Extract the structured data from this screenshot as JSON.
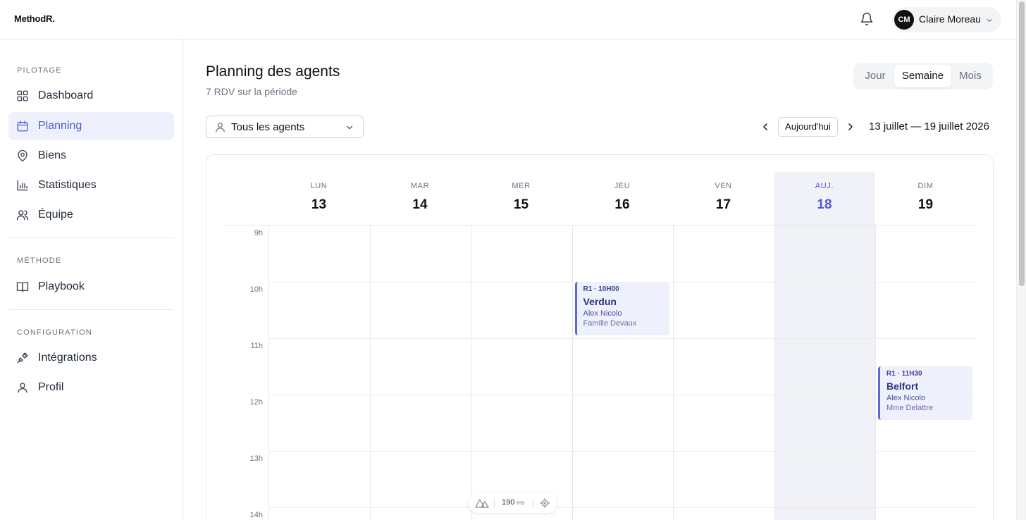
{
  "app": {
    "logo": "MethodR."
  },
  "user": {
    "initials": "CM",
    "name": "Claire Moreau"
  },
  "sidebar": {
    "sections": [
      {
        "label": "PILOTAGE"
      },
      {
        "label": "MÉTHODE"
      },
      {
        "label": "CONFIGURATION"
      }
    ],
    "items": [
      {
        "label": "Dashboard",
        "icon": "grid-icon"
      },
      {
        "label": "Planning",
        "icon": "calendar-icon",
        "active": true
      },
      {
        "label": "Biens",
        "icon": "map-pin-icon"
      },
      {
        "label": "Statistiques",
        "icon": "bar-chart-icon"
      },
      {
        "label": "Équipe",
        "icon": "users-icon"
      },
      {
        "label": "Playbook",
        "icon": "book-icon"
      },
      {
        "label": "Intégrations",
        "icon": "plug-icon"
      },
      {
        "label": "Profil",
        "icon": "user-icon"
      }
    ]
  },
  "page": {
    "title": "Planning des agents",
    "subtitle": "7 RDV sur la période"
  },
  "view_toggle": {
    "options": [
      "Jour",
      "Semaine",
      "Mois"
    ],
    "selected": "Semaine"
  },
  "filter": {
    "agent_label": "Tous les agents"
  },
  "date_nav": {
    "today_label": "Aujourd'hui",
    "range": "13 juillet — 19 juillet 2026"
  },
  "calendar": {
    "days": [
      {
        "name": "LUN",
        "num": "13"
      },
      {
        "name": "MAR",
        "num": "14"
      },
      {
        "name": "MER",
        "num": "15"
      },
      {
        "name": "JEU",
        "num": "16"
      },
      {
        "name": "VEN",
        "num": "17"
      },
      {
        "name": "AUJ.",
        "num": "18",
        "today": true
      },
      {
        "name": "DIM",
        "num": "19"
      }
    ],
    "hours": [
      "9h",
      "10h",
      "11h",
      "12h",
      "13h",
      "14h"
    ],
    "events": [
      {
        "day_index": 3,
        "start_hour": 10.0,
        "time": "R1 · 10H00",
        "title": "Verdun",
        "agent": "Alex Nicolo",
        "client": "Famille Devaux"
      },
      {
        "day_index": 6,
        "start_hour": 11.5,
        "time": "R1 · 11H30",
        "title": "Belfort",
        "agent": "Alex Nicolo",
        "client": "Mme Delattre"
      }
    ]
  },
  "perf_bar": {
    "value": "190",
    "unit": "ms"
  },
  "colors": {
    "accent": "#4f5bd5",
    "event_bg": "#eef0fb",
    "today_col": "#f1f2f7"
  }
}
